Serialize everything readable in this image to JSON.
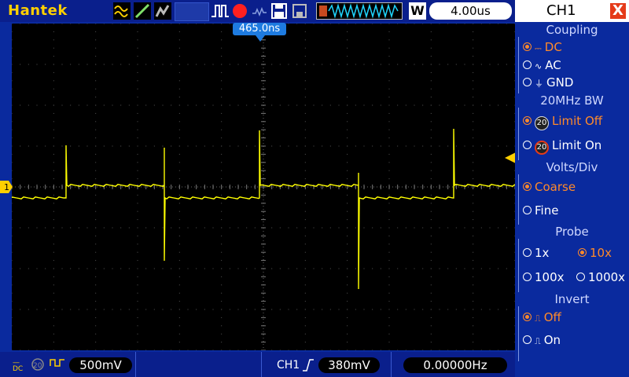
{
  "topbar": {
    "brand": "Hantek",
    "timebase": "4.00us",
    "trigger_delay": "465.0ns",
    "memory_label": "W"
  },
  "channel": {
    "marker": "1",
    "trace_color": "#ffff00"
  },
  "bottombar": {
    "ch1_scale": "500mV",
    "trigger_source": "CH1",
    "trigger_level": "380mV",
    "frequency": "0.00000Hz"
  },
  "panel": {
    "title": "CH1",
    "close_label": "X",
    "coupling": {
      "title": "Coupling",
      "options": [
        {
          "label": "DC",
          "icon": "dc-icon",
          "selected": true
        },
        {
          "label": "AC",
          "icon": "ac-icon",
          "selected": false
        },
        {
          "label": "GND",
          "icon": "ground-icon",
          "selected": false
        }
      ]
    },
    "bw": {
      "title": "20MHz BW",
      "options": [
        {
          "label": "Limit Off",
          "badge": "20",
          "selected": true
        },
        {
          "label": "Limit On",
          "badge": "20",
          "selected": false
        }
      ]
    },
    "volts": {
      "title": "Volts/Div",
      "options": [
        {
          "label": "Coarse",
          "selected": true
        },
        {
          "label": "Fine",
          "selected": false
        }
      ]
    },
    "probe": {
      "title": "Probe",
      "options": [
        {
          "label": "1x",
          "selected": false
        },
        {
          "label": "10x",
          "selected": true
        },
        {
          "label": "100x",
          "selected": false
        },
        {
          "label": "1000x",
          "selected": false
        }
      ]
    },
    "invert": {
      "title": "Invert",
      "options": [
        {
          "label": "Off",
          "selected": true
        },
        {
          "label": "On",
          "selected": false
        }
      ]
    }
  },
  "colors": {
    "accent": "#ffd000",
    "selected": "#ff8a2a",
    "trace": "#ffff00"
  }
}
